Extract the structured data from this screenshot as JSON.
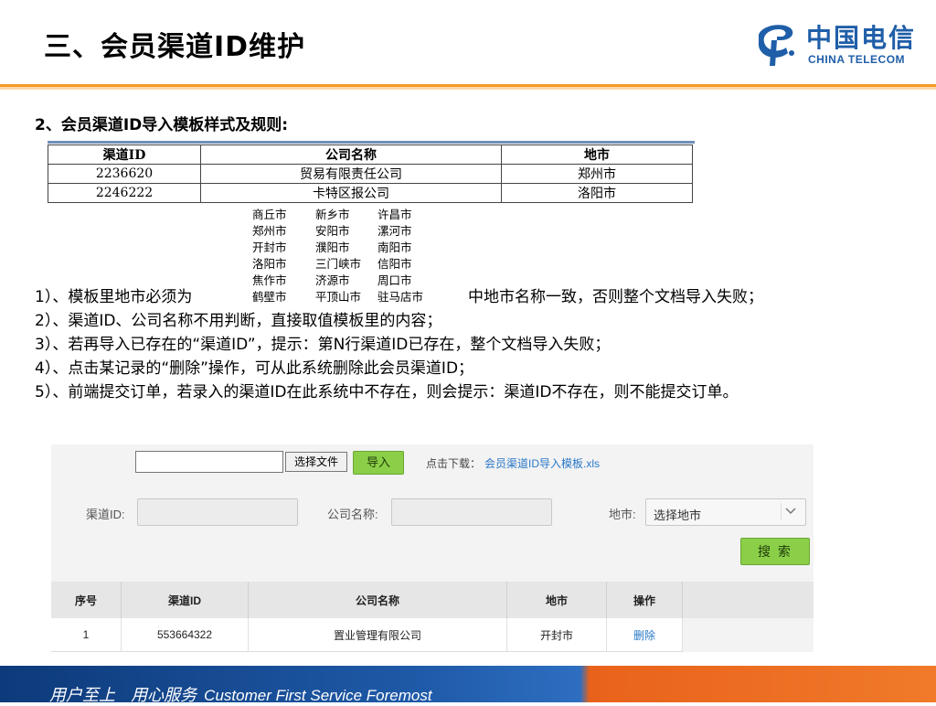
{
  "header": {
    "title": "三、会员渠道ID维护",
    "logo_cn": "中国电信",
    "logo_en": "CHINA TELECOM"
  },
  "subtitle": "2、会员渠道ID导入模板样式及规则:",
  "template_table": {
    "headers": [
      "渠道ID",
      "公司名称",
      "地市"
    ],
    "rows": [
      [
        "2236620",
        "贸易有限责任公司",
        "郑州市"
      ],
      [
        "2246222",
        "卡特区报公司",
        "洛阳市"
      ]
    ]
  },
  "cities": [
    [
      "商丘市",
      "新乡市",
      "许昌市"
    ],
    [
      "郑州市",
      "安阳市",
      "漯河市"
    ],
    [
      "开封市",
      "濮阳市",
      "南阳市"
    ],
    [
      "洛阳市",
      "三门峡市",
      "信阳市"
    ],
    [
      "焦作市",
      "济源市",
      "周口市"
    ],
    [
      "鹤壁市",
      "平顶山市",
      "驻马店市"
    ]
  ],
  "rules": {
    "r1_prefix": "1）、模板里地市必须为",
    "r1_suffix": "中地市名称一致，否则整个文档导入失败；",
    "r2": "2）、渠道ID、公司名称不用判断，直接取值模板里的内容；",
    "r3": "3）、若再导入已存在的“渠道ID”，提示：第N行渠道ID已存在，整个文档导入失败；",
    "r4": "4）、点击某记录的“删除”操作，可从此系统删除此会员渠道ID；",
    "r5": "5）、前端提交订单，若录入的渠道ID在此系统中不存在，则会提示：渠道ID不存在，则不能提交订单。"
  },
  "ui": {
    "choose_file": "选择文件",
    "import": "导入",
    "download_label": "点击下载：",
    "download_link": "会员渠道ID导入模板.xls",
    "channel_label": "渠道ID:",
    "company_label": "公司名称:",
    "city_label": "地市:",
    "city_placeholder": "选择地市",
    "search": "搜 索",
    "table": {
      "headers": [
        "序号",
        "渠道ID",
        "公司名称",
        "地市",
        "操作"
      ],
      "rows": [
        {
          "index": "1",
          "channel_id": "553664322",
          "company": "置业管理有限公司",
          "city": "开封市",
          "op": "删除"
        }
      ]
    }
  },
  "footer": {
    "cn": "用户至上   用心服务",
    "en": "Customer First Service Foremost"
  },
  "colors": {
    "accent_orange": "#f59a23",
    "brand_blue": "#1f5ea8",
    "button_green": "#8bcf49",
    "link_blue": "#2a78c8"
  }
}
